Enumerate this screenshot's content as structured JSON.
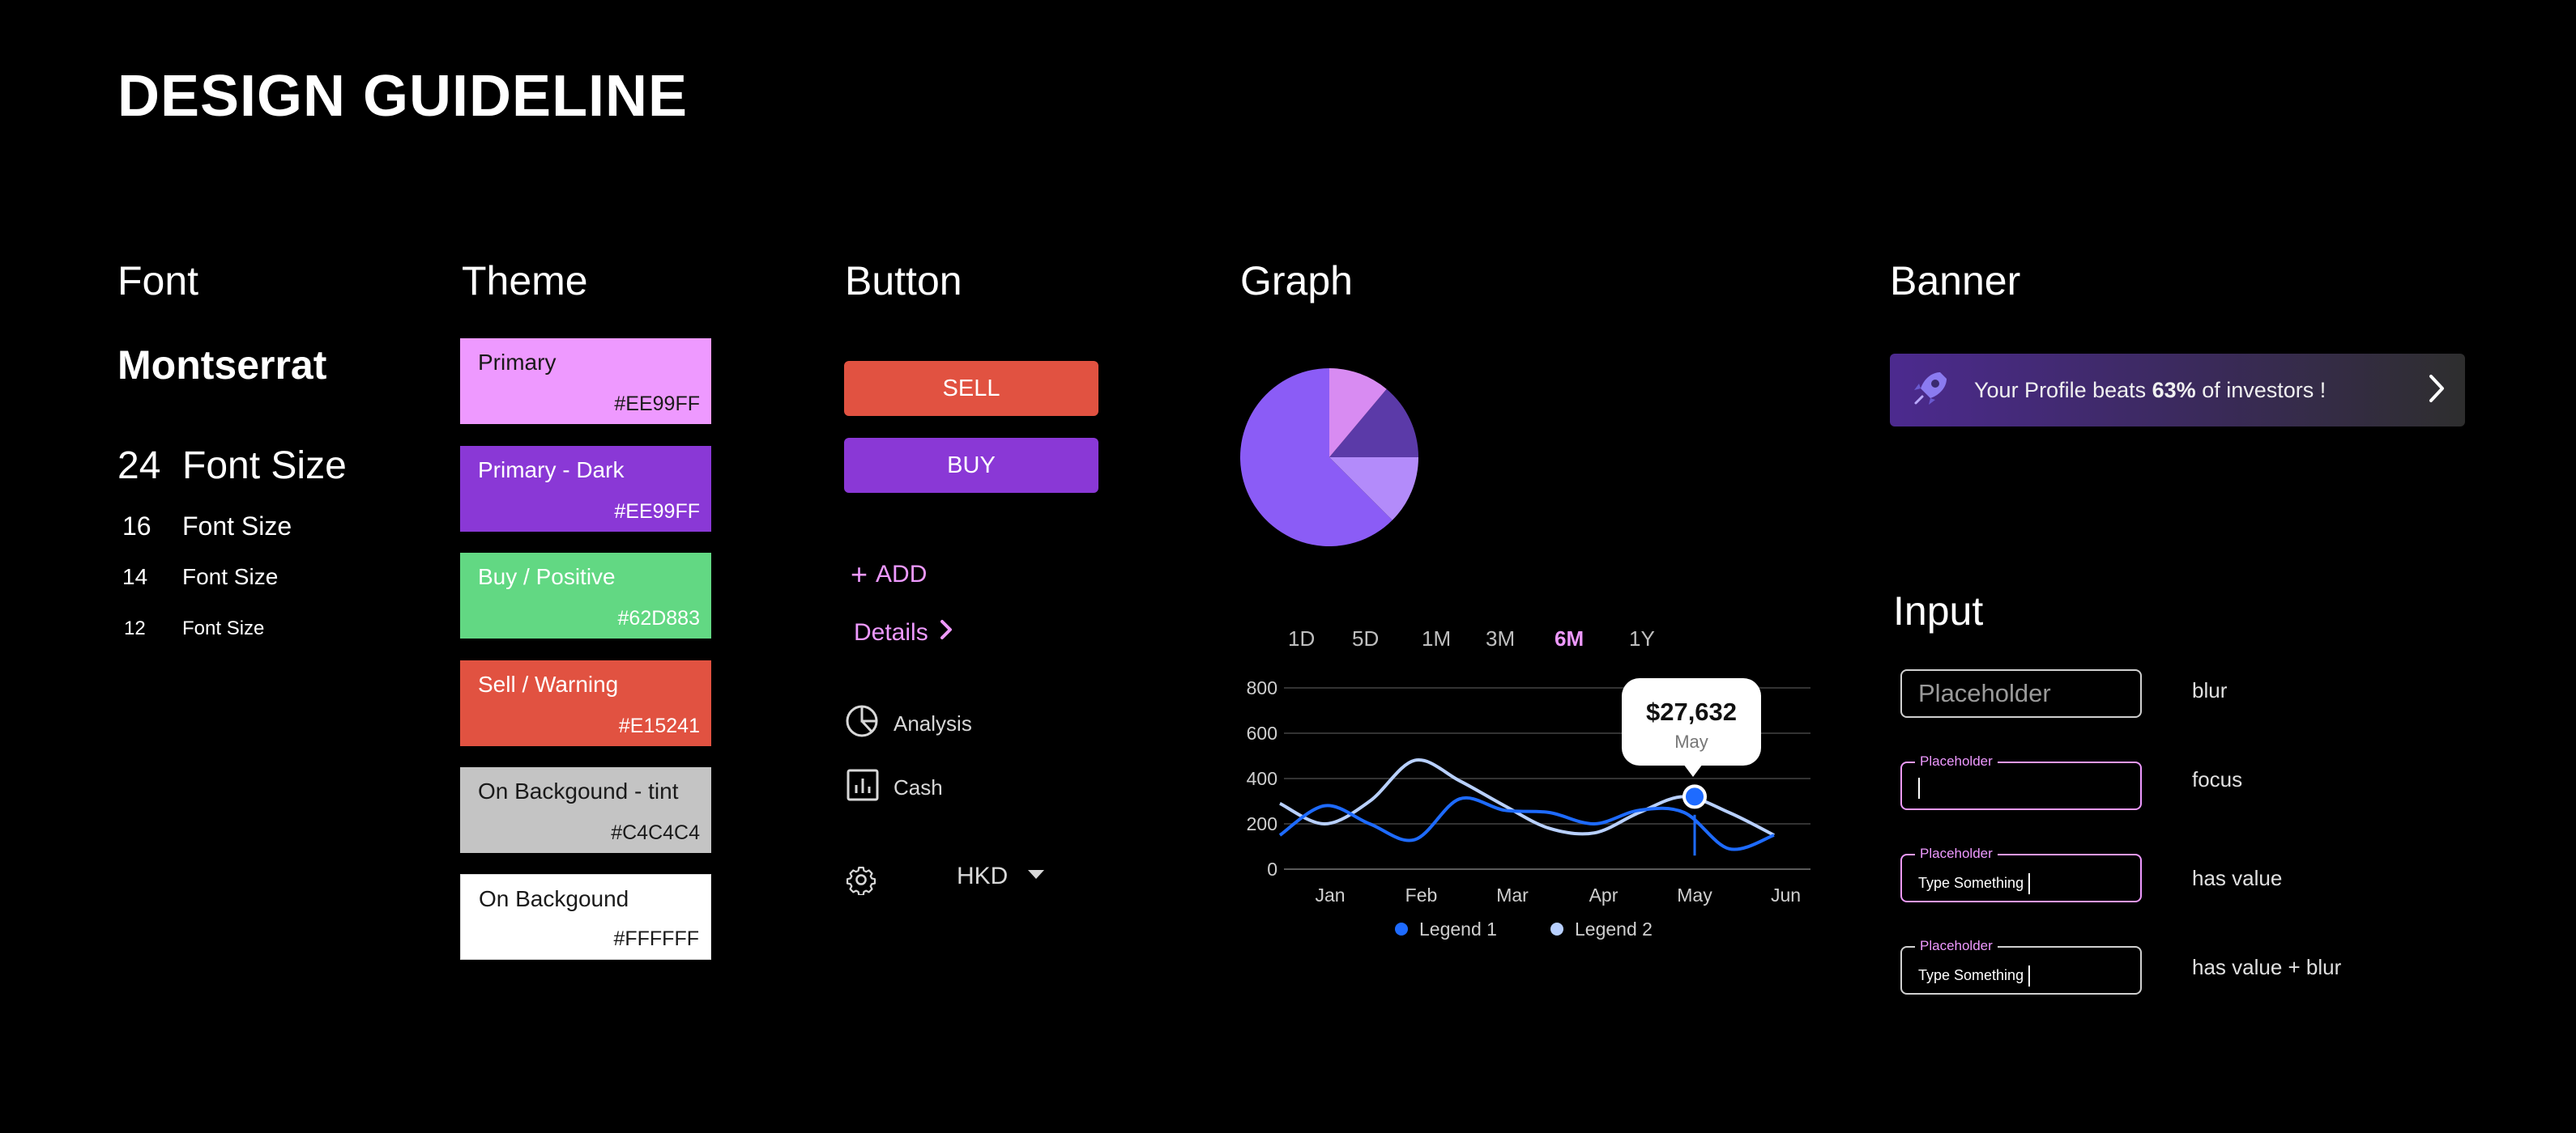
{
  "page_title": "DESIGN GUIDELINE",
  "font": {
    "title": "Font",
    "family_name": "Montserrat",
    "sizes": [
      {
        "num": "24",
        "label": "Font Size"
      },
      {
        "num": "16",
        "label": "Font Size"
      },
      {
        "num": "14",
        "label": "Font Size"
      },
      {
        "num": "12",
        "label": "Font Size"
      }
    ]
  },
  "theme": {
    "title": "Theme",
    "swatches": [
      {
        "name": "Primary",
        "hex": "#EE99FF",
        "color": "#EE99FF",
        "text_color": "#1a1a1a"
      },
      {
        "name": "Primary - Dark",
        "hex": "#EE99FF",
        "color": "#8A38D6",
        "text_color": "#ffffff"
      },
      {
        "name": "Buy / Positive",
        "hex": "#62D883",
        "color": "#62D883",
        "text_color": "#ffffff"
      },
      {
        "name": "Sell / Warning",
        "hex": "#E15241",
        "color": "#E15241",
        "text_color": "#ffffff"
      },
      {
        "name": "On Backgound - tint",
        "hex": "#C4C4C4",
        "color": "#C4C4C4",
        "text_color": "#1a1a1a"
      },
      {
        "name": "On Backgound",
        "hex": "#FFFFFF",
        "color": "#FFFFFF",
        "text_color": "#1a1a1a"
      }
    ]
  },
  "button": {
    "title": "Button",
    "sell_label": "SELL",
    "buy_label": "BUY",
    "add_label": "ADD",
    "details_label": "Details",
    "analysis_label": "Analysis",
    "cash_label": "Cash",
    "currency_label": "HKD"
  },
  "graph": {
    "title": "Graph",
    "timeframes": [
      "1D",
      "5D",
      "1M",
      "3M",
      "6M",
      "1Y"
    ],
    "active_timeframe": "6M",
    "tooltip_value": "$27,632",
    "tooltip_label": "May",
    "pie_colors": [
      "#8B5CF6",
      "#B38BFA",
      "#5B3AA8",
      "#D88BF2"
    ]
  },
  "chart_data": {
    "type": "line",
    "categories": [
      "Jan",
      "Feb",
      "Mar",
      "Apr",
      "May",
      "Jun"
    ],
    "ylim": [
      0,
      800
    ],
    "yticks": [
      0,
      200,
      400,
      600,
      800
    ],
    "grid": true,
    "legend_placement": "bottom",
    "series": [
      {
        "name": "Legend 1",
        "color": "#1E6BFF",
        "values": [
          150,
          280,
          200,
          130,
          310,
          260,
          250,
          200,
          260,
          250,
          90,
          150
        ]
      },
      {
        "name": "Legend 2",
        "color": "#B8D0FF",
        "values": [
          290,
          200,
          300,
          480,
          390,
          280,
          180,
          160,
          250,
          320,
          250,
          150
        ]
      }
    ],
    "highlight": {
      "x": "May",
      "value": 27632
    }
  },
  "banner": {
    "title": "Banner",
    "text_before": "Your Profile beats ",
    "text_bold": "63%",
    "text_after": " of investors !"
  },
  "input": {
    "title": "Input",
    "placeholder": "Placeholder",
    "value": "Type Something",
    "states": [
      "blur",
      "focus",
      "has value",
      "has value + blur"
    ]
  }
}
